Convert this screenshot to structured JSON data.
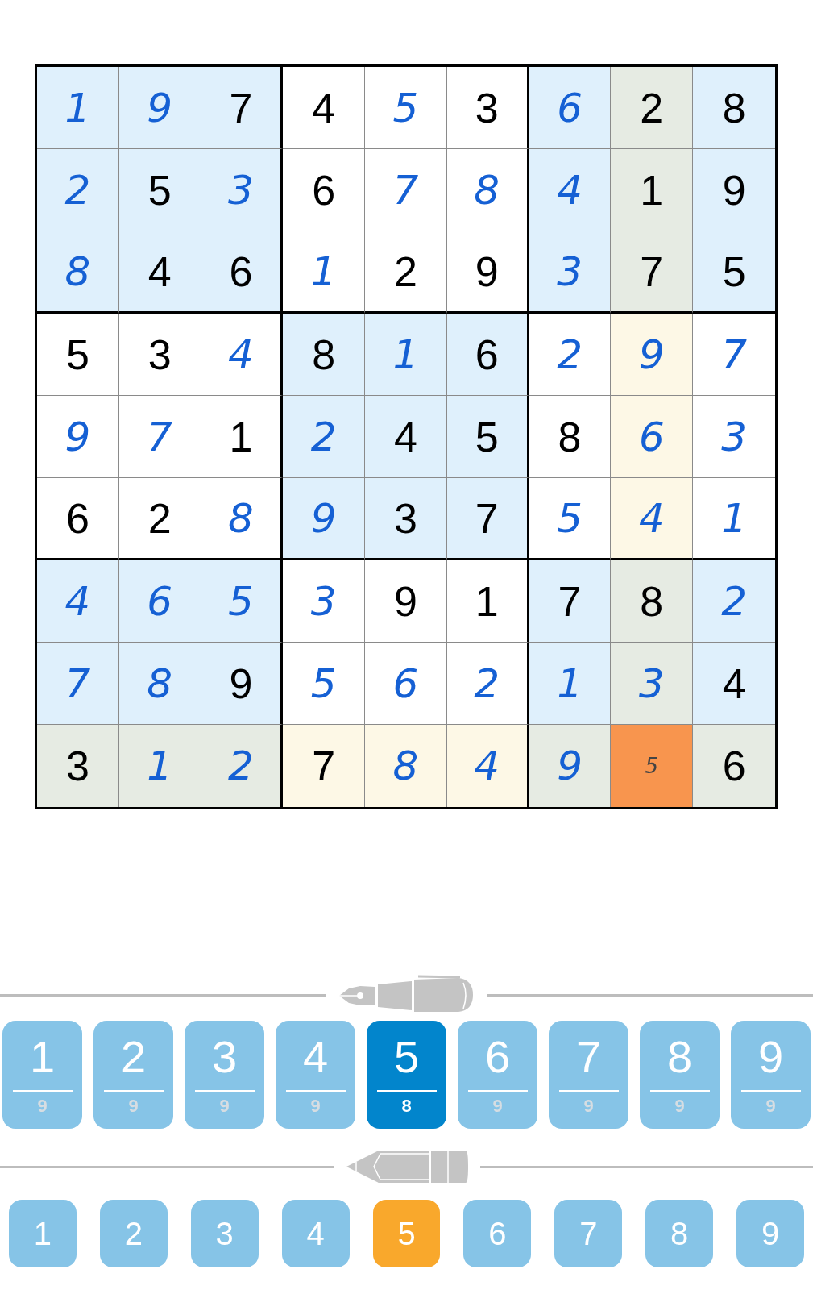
{
  "grid": [
    {
      "cells": [
        {
          "value": "1",
          "given": false,
          "color": "#dff0fc"
        },
        {
          "value": "9",
          "given": false,
          "color": "#dff0fc"
        },
        {
          "value": "7",
          "given": true,
          "color": "#dff0fc"
        },
        {
          "value": "4",
          "given": true,
          "color": "#ffffff"
        },
        {
          "value": "5",
          "given": false,
          "color": "#ffffff"
        },
        {
          "value": "3",
          "given": true,
          "color": "#ffffff"
        },
        {
          "value": "6",
          "given": false,
          "color": "#dff0fc"
        },
        {
          "value": "2",
          "given": true,
          "color": "#e6ebe3"
        },
        {
          "value": "8",
          "given": true,
          "color": "#dff0fc"
        }
      ]
    },
    {
      "cells": [
        {
          "value": "2",
          "given": false,
          "color": "#dff0fc"
        },
        {
          "value": "5",
          "given": true,
          "color": "#dff0fc"
        },
        {
          "value": "3",
          "given": false,
          "color": "#dff0fc"
        },
        {
          "value": "6",
          "given": true,
          "color": "#ffffff"
        },
        {
          "value": "7",
          "given": false,
          "color": "#ffffff"
        },
        {
          "value": "8",
          "given": false,
          "color": "#ffffff"
        },
        {
          "value": "4",
          "given": false,
          "color": "#dff0fc"
        },
        {
          "value": "1",
          "given": true,
          "color": "#e6ebe3"
        },
        {
          "value": "9",
          "given": true,
          "color": "#dff0fc"
        }
      ]
    },
    {
      "cells": [
        {
          "value": "8",
          "given": false,
          "color": "#dff0fc"
        },
        {
          "value": "4",
          "given": true,
          "color": "#dff0fc"
        },
        {
          "value": "6",
          "given": true,
          "color": "#dff0fc"
        },
        {
          "value": "1",
          "given": false,
          "color": "#ffffff"
        },
        {
          "value": "2",
          "given": true,
          "color": "#ffffff"
        },
        {
          "value": "9",
          "given": true,
          "color": "#ffffff"
        },
        {
          "value": "3",
          "given": false,
          "color": "#dff0fc"
        },
        {
          "value": "7",
          "given": true,
          "color": "#e6ebe3"
        },
        {
          "value": "5",
          "given": true,
          "color": "#dff0fc"
        }
      ]
    },
    {
      "cells": [
        {
          "value": "5",
          "given": true,
          "color": "#ffffff"
        },
        {
          "value": "3",
          "given": true,
          "color": "#ffffff"
        },
        {
          "value": "4",
          "given": false,
          "color": "#ffffff"
        },
        {
          "value": "8",
          "given": true,
          "color": "#dff0fc"
        },
        {
          "value": "1",
          "given": false,
          "color": "#dff0fc"
        },
        {
          "value": "6",
          "given": true,
          "color": "#dff0fc"
        },
        {
          "value": "2",
          "given": false,
          "color": "#ffffff"
        },
        {
          "value": "9",
          "given": false,
          "color": "#fdf8e6"
        },
        {
          "value": "7",
          "given": false,
          "color": "#ffffff"
        }
      ]
    },
    {
      "cells": [
        {
          "value": "9",
          "given": false,
          "color": "#ffffff"
        },
        {
          "value": "7",
          "given": false,
          "color": "#ffffff"
        },
        {
          "value": "1",
          "given": true,
          "color": "#ffffff"
        },
        {
          "value": "2",
          "given": false,
          "color": "#dff0fc"
        },
        {
          "value": "4",
          "given": true,
          "color": "#dff0fc"
        },
        {
          "value": "5",
          "given": true,
          "color": "#dff0fc"
        },
        {
          "value": "8",
          "given": true,
          "color": "#ffffff"
        },
        {
          "value": "6",
          "given": false,
          "color": "#fdf8e6"
        },
        {
          "value": "3",
          "given": false,
          "color": "#ffffff"
        }
      ]
    },
    {
      "cells": [
        {
          "value": "6",
          "given": true,
          "color": "#ffffff"
        },
        {
          "value": "2",
          "given": true,
          "color": "#ffffff"
        },
        {
          "value": "8",
          "given": false,
          "color": "#ffffff"
        },
        {
          "value": "9",
          "given": false,
          "color": "#dff0fc"
        },
        {
          "value": "3",
          "given": true,
          "color": "#dff0fc"
        },
        {
          "value": "7",
          "given": true,
          "color": "#dff0fc"
        },
        {
          "value": "5",
          "given": false,
          "color": "#ffffff"
        },
        {
          "value": "4",
          "given": false,
          "color": "#fdf8e6"
        },
        {
          "value": "1",
          "given": false,
          "color": "#ffffff"
        }
      ]
    },
    {
      "cells": [
        {
          "value": "4",
          "given": false,
          "color": "#dff0fc"
        },
        {
          "value": "6",
          "given": false,
          "color": "#dff0fc"
        },
        {
          "value": "5",
          "given": false,
          "color": "#dff0fc"
        },
        {
          "value": "3",
          "given": false,
          "color": "#ffffff"
        },
        {
          "value": "9",
          "given": true,
          "color": "#ffffff"
        },
        {
          "value": "1",
          "given": true,
          "color": "#ffffff"
        },
        {
          "value": "7",
          "given": true,
          "color": "#dff0fc"
        },
        {
          "value": "8",
          "given": true,
          "color": "#e6ebe3"
        },
        {
          "value": "2",
          "given": false,
          "color": "#dff0fc"
        }
      ]
    },
    {
      "cells": [
        {
          "value": "7",
          "given": false,
          "color": "#dff0fc"
        },
        {
          "value": "8",
          "given": false,
          "color": "#dff0fc"
        },
        {
          "value": "9",
          "given": true,
          "color": "#dff0fc"
        },
        {
          "value": "5",
          "given": false,
          "color": "#ffffff"
        },
        {
          "value": "6",
          "given": false,
          "color": "#ffffff"
        },
        {
          "value": "2",
          "given": false,
          "color": "#ffffff"
        },
        {
          "value": "1",
          "given": false,
          "color": "#dff0fc"
        },
        {
          "value": "3",
          "given": false,
          "color": "#e6ebe3"
        },
        {
          "value": "4",
          "given": true,
          "color": "#dff0fc"
        }
      ]
    },
    {
      "cells": [
        {
          "value": "3",
          "given": true,
          "color": "#e6ebe3"
        },
        {
          "value": "1",
          "given": false,
          "color": "#e6ebe3"
        },
        {
          "value": "2",
          "given": false,
          "color": "#e6ebe3"
        },
        {
          "value": "7",
          "given": true,
          "color": "#fdf8e6"
        },
        {
          "value": "8",
          "given": false,
          "color": "#fdf8e6"
        },
        {
          "value": "4",
          "given": false,
          "color": "#fdf8e6"
        },
        {
          "value": "9",
          "given": false,
          "color": "#e6ebe3"
        },
        {
          "note": "5",
          "color": "#f8954e"
        },
        {
          "value": "6",
          "given": true,
          "color": "#e6ebe3"
        }
      ]
    }
  ],
  "pen_buttons": [
    {
      "digit": "1",
      "count": "9",
      "selected": false
    },
    {
      "digit": "2",
      "count": "9",
      "selected": false
    },
    {
      "digit": "3",
      "count": "9",
      "selected": false
    },
    {
      "digit": "4",
      "count": "9",
      "selected": false
    },
    {
      "digit": "5",
      "count": "8",
      "selected": true
    },
    {
      "digit": "6",
      "count": "9",
      "selected": false
    },
    {
      "digit": "7",
      "count": "9",
      "selected": false
    },
    {
      "digit": "8",
      "count": "9",
      "selected": false
    },
    {
      "digit": "9",
      "count": "9",
      "selected": false
    }
  ],
  "pencil_buttons": [
    {
      "digit": "1",
      "selected": false
    },
    {
      "digit": "2",
      "selected": false
    },
    {
      "digit": "3",
      "selected": false
    },
    {
      "digit": "4",
      "selected": false
    },
    {
      "digit": "5",
      "selected": true
    },
    {
      "digit": "6",
      "selected": false
    },
    {
      "digit": "7",
      "selected": false
    },
    {
      "digit": "8",
      "selected": false
    },
    {
      "digit": "9",
      "selected": false
    }
  ]
}
